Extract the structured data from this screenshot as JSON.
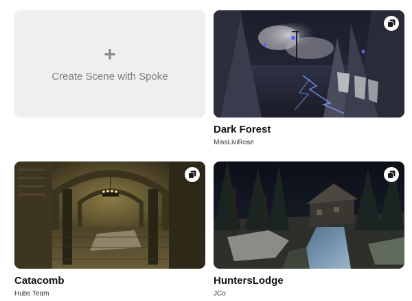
{
  "create": {
    "icon": "plus-icon",
    "plus_glyph": "+",
    "label": "Create Scene with Spoke"
  },
  "scenes": [
    {
      "title": "Dark Forest",
      "author": "MissLiviRose",
      "badge_icon": "copy-icon"
    },
    {
      "title": "Catacomb",
      "author": "Hubs Team",
      "badge_icon": "copy-icon"
    },
    {
      "title": "HuntersLodge",
      "author": "JCo",
      "badge_icon": "copy-icon"
    }
  ],
  "colors": {
    "create_tile_bg": "#efefef",
    "create_text": "#7d7d7d",
    "title_text": "#111111",
    "author_text": "#333333"
  }
}
